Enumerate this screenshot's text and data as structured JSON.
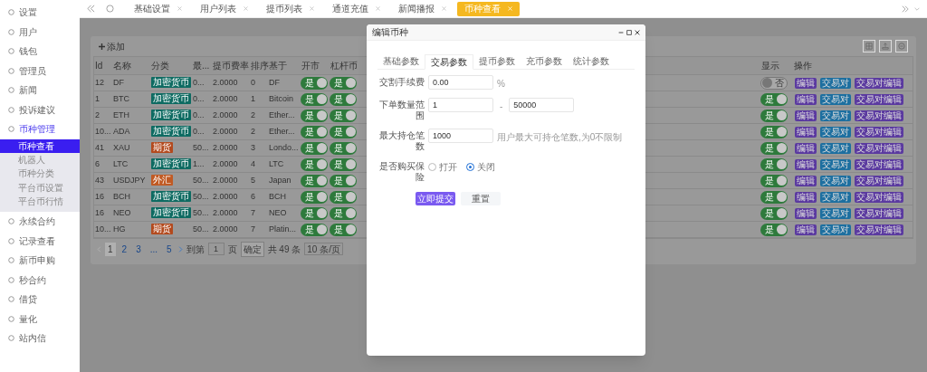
{
  "sidebar": {
    "items": [
      {
        "label": "设置",
        "selected": false
      },
      {
        "label": "用户",
        "selected": false
      },
      {
        "label": "钱包",
        "selected": false
      },
      {
        "label": "管理员",
        "selected": false
      },
      {
        "label": "新闻",
        "selected": false
      },
      {
        "label": "投诉建议",
        "selected": false
      },
      {
        "label": "币种管理",
        "selected": false,
        "expanded": true,
        "children": [
          {
            "label": "币种查看",
            "selected": true
          },
          {
            "label": "机器人",
            "selected": false
          },
          {
            "label": "币种分类",
            "selected": false
          },
          {
            "label": "平台币设置",
            "selected": false
          },
          {
            "label": "平台币行情",
            "selected": false
          }
        ]
      },
      {
        "label": "永续合约",
        "selected": false
      },
      {
        "label": "记录查看",
        "selected": false
      },
      {
        "label": "新币申购",
        "selected": false
      },
      {
        "label": "秒合约",
        "selected": false
      },
      {
        "label": "借贷",
        "selected": false
      },
      {
        "label": "量化",
        "selected": false
      },
      {
        "label": "站内信",
        "selected": false
      }
    ]
  },
  "tabs": [
    {
      "label": "基础设置",
      "selected": false
    },
    {
      "label": "用户列表",
      "selected": false
    },
    {
      "label": "提币列表",
      "selected": false
    },
    {
      "label": "通道充值",
      "selected": false
    },
    {
      "label": "新闻播报",
      "selected": false
    },
    {
      "label": "币种查看",
      "selected": true
    }
  ],
  "toolbar": {
    "add_button": "添加"
  },
  "table": {
    "columns": [
      "Id",
      "名称",
      "分类",
      "最...",
      "提币费率",
      "排序",
      "基于",
      "开市",
      "杠杆币",
      "显示",
      "操作"
    ],
    "rows": [
      {
        "id": "12",
        "name": "DF",
        "category": "加密货币",
        "color": "#0e6b62",
        "col4": "0...",
        "fee": "2.0000",
        "sort": "0",
        "base": "DF",
        "open": {
          "on": true,
          "label": "是"
        },
        "leverage": {
          "on": true,
          "label": "是"
        },
        "display": {
          "on": false,
          "label": "否"
        },
        "actions": [
          "编辑",
          "交易对",
          "交易对编辑"
        ]
      },
      {
        "id": "1",
        "name": "BTC",
        "category": "加密货币",
        "color": "#0e6b62",
        "col4": "0...",
        "fee": "2.0000",
        "sort": "1",
        "base": "Bitcoin",
        "open": {
          "on": true,
          "label": "是"
        },
        "leverage": {
          "on": true,
          "label": "是"
        },
        "display": {
          "on": true,
          "label": "是"
        },
        "actions": [
          "编辑",
          "交易对",
          "交易对编辑"
        ]
      },
      {
        "id": "2",
        "name": "ETH",
        "category": "加密货币",
        "color": "#0e6b62",
        "col4": "0...",
        "fee": "2.0000",
        "sort": "2",
        "base": "Ether...",
        "open": {
          "on": true,
          "label": "是"
        },
        "leverage": {
          "on": true,
          "label": "是"
        },
        "display": {
          "on": true,
          "label": "是"
        },
        "actions": [
          "编辑",
          "交易对",
          "交易对编辑"
        ]
      },
      {
        "id": "10...",
        "name": "ADA",
        "category": "加密货币",
        "color": "#0e6b62",
        "col4": "0...",
        "fee": "2.0000",
        "sort": "2",
        "base": "Ether...",
        "open": {
          "on": true,
          "label": "是"
        },
        "leverage": {
          "on": true,
          "label": "是"
        },
        "display": {
          "on": true,
          "label": "是"
        },
        "actions": [
          "编辑",
          "交易对",
          "交易对编辑"
        ]
      },
      {
        "id": "41",
        "name": "XAU",
        "category": "期货",
        "color": "#b34a1e",
        "col4": "50...",
        "fee": "2.0000",
        "sort": "3",
        "base": "Londo...",
        "open": {
          "on": true,
          "label": "是"
        },
        "leverage": {
          "on": true,
          "label": "是"
        },
        "display": {
          "on": true,
          "label": "是"
        },
        "actions": [
          "编辑",
          "交易对",
          "交易对编辑"
        ]
      },
      {
        "id": "6",
        "name": "LTC",
        "category": "加密货币",
        "color": "#0e6b62",
        "col4": "1...",
        "fee": "2.0000",
        "sort": "4",
        "base": "LTC",
        "open": {
          "on": true,
          "label": "是"
        },
        "leverage": {
          "on": true,
          "label": "是"
        },
        "display": {
          "on": true,
          "label": "是"
        },
        "actions": [
          "编辑",
          "交易对",
          "交易对编辑"
        ]
      },
      {
        "id": "43",
        "name": "USDJPY",
        "category": "外汇",
        "color": "#c05a24",
        "col4": "50...",
        "fee": "2.0000",
        "sort": "5",
        "base": "Japan",
        "open": {
          "on": true,
          "label": "是"
        },
        "leverage": {
          "on": true,
          "label": "是"
        },
        "display": {
          "on": true,
          "label": "是"
        },
        "actions": [
          "编辑",
          "交易对",
          "交易对编辑"
        ]
      },
      {
        "id": "16",
        "name": "BCH",
        "category": "加密货币",
        "color": "#0e6b62",
        "col4": "50...",
        "fee": "2.0000",
        "sort": "6",
        "base": "BCH",
        "open": {
          "on": true,
          "label": "是"
        },
        "leverage": {
          "on": true,
          "label": "是"
        },
        "display": {
          "on": true,
          "label": "是"
        },
        "actions": [
          "编辑",
          "交易对",
          "交易对编辑"
        ]
      },
      {
        "id": "16",
        "name": "NEO",
        "category": "加密货币",
        "color": "#0e6b62",
        "col4": "50...",
        "fee": "2.0000",
        "sort": "7",
        "base": "NEO",
        "open": {
          "on": true,
          "label": "是"
        },
        "leverage": {
          "on": true,
          "label": "是"
        },
        "display": {
          "on": true,
          "label": "是"
        },
        "actions": [
          "编辑",
          "交易对",
          "交易对编辑"
        ]
      },
      {
        "id": "10...",
        "name": "HG",
        "category": "期货",
        "color": "#b34a1e",
        "col4": "50...",
        "fee": "2.0000",
        "sort": "7",
        "base": "Platin...",
        "open": {
          "on": true,
          "label": "是"
        },
        "leverage": {
          "on": true,
          "label": "是"
        },
        "display": {
          "on": true,
          "label": "是"
        },
        "actions": [
          "编辑",
          "交易对",
          "交易对编辑"
        ]
      }
    ]
  },
  "pagination": {
    "pages": [
      {
        "label": "1",
        "selected": true
      },
      {
        "label": "2",
        "selected": false
      },
      {
        "label": "3",
        "selected": false
      },
      {
        "label": "...",
        "selected": false
      },
      {
        "label": "5",
        "selected": false
      }
    ],
    "goto_label": "到第",
    "goto_value": "1",
    "page_unit": "页",
    "confirm": "确定",
    "total": "共 49 条",
    "page_size": "10 条/页"
  },
  "modal": {
    "title": "编辑币种",
    "tabs": [
      {
        "label": "基础参数",
        "selected": false
      },
      {
        "label": "交易参数",
        "selected": true
      },
      {
        "label": "提币参数",
        "selected": false
      },
      {
        "label": "充币参数",
        "selected": false
      },
      {
        "label": "统计参数",
        "selected": false
      }
    ],
    "fields": [
      {
        "kind": "single",
        "label": "交割手续费",
        "value": "0.00",
        "suffix": "%"
      },
      {
        "kind": "range",
        "label": "下单数量范围",
        "value": "1",
        "separator": "-",
        "value2": "50000"
      },
      {
        "kind": "single",
        "label": "最大持仓笔数",
        "value": "1000",
        "suffix": "用户最大可持仓笔数,为0不限制"
      },
      {
        "kind": "radio",
        "label": "是否购买保险",
        "options": [
          {
            "label": "打开",
            "selected": false
          },
          {
            "label": "关闭",
            "selected": true
          }
        ]
      }
    ],
    "buttons": [
      {
        "label": "立即提交",
        "kind": "primary"
      },
      {
        "label": "重置",
        "kind": "plain"
      }
    ]
  }
}
